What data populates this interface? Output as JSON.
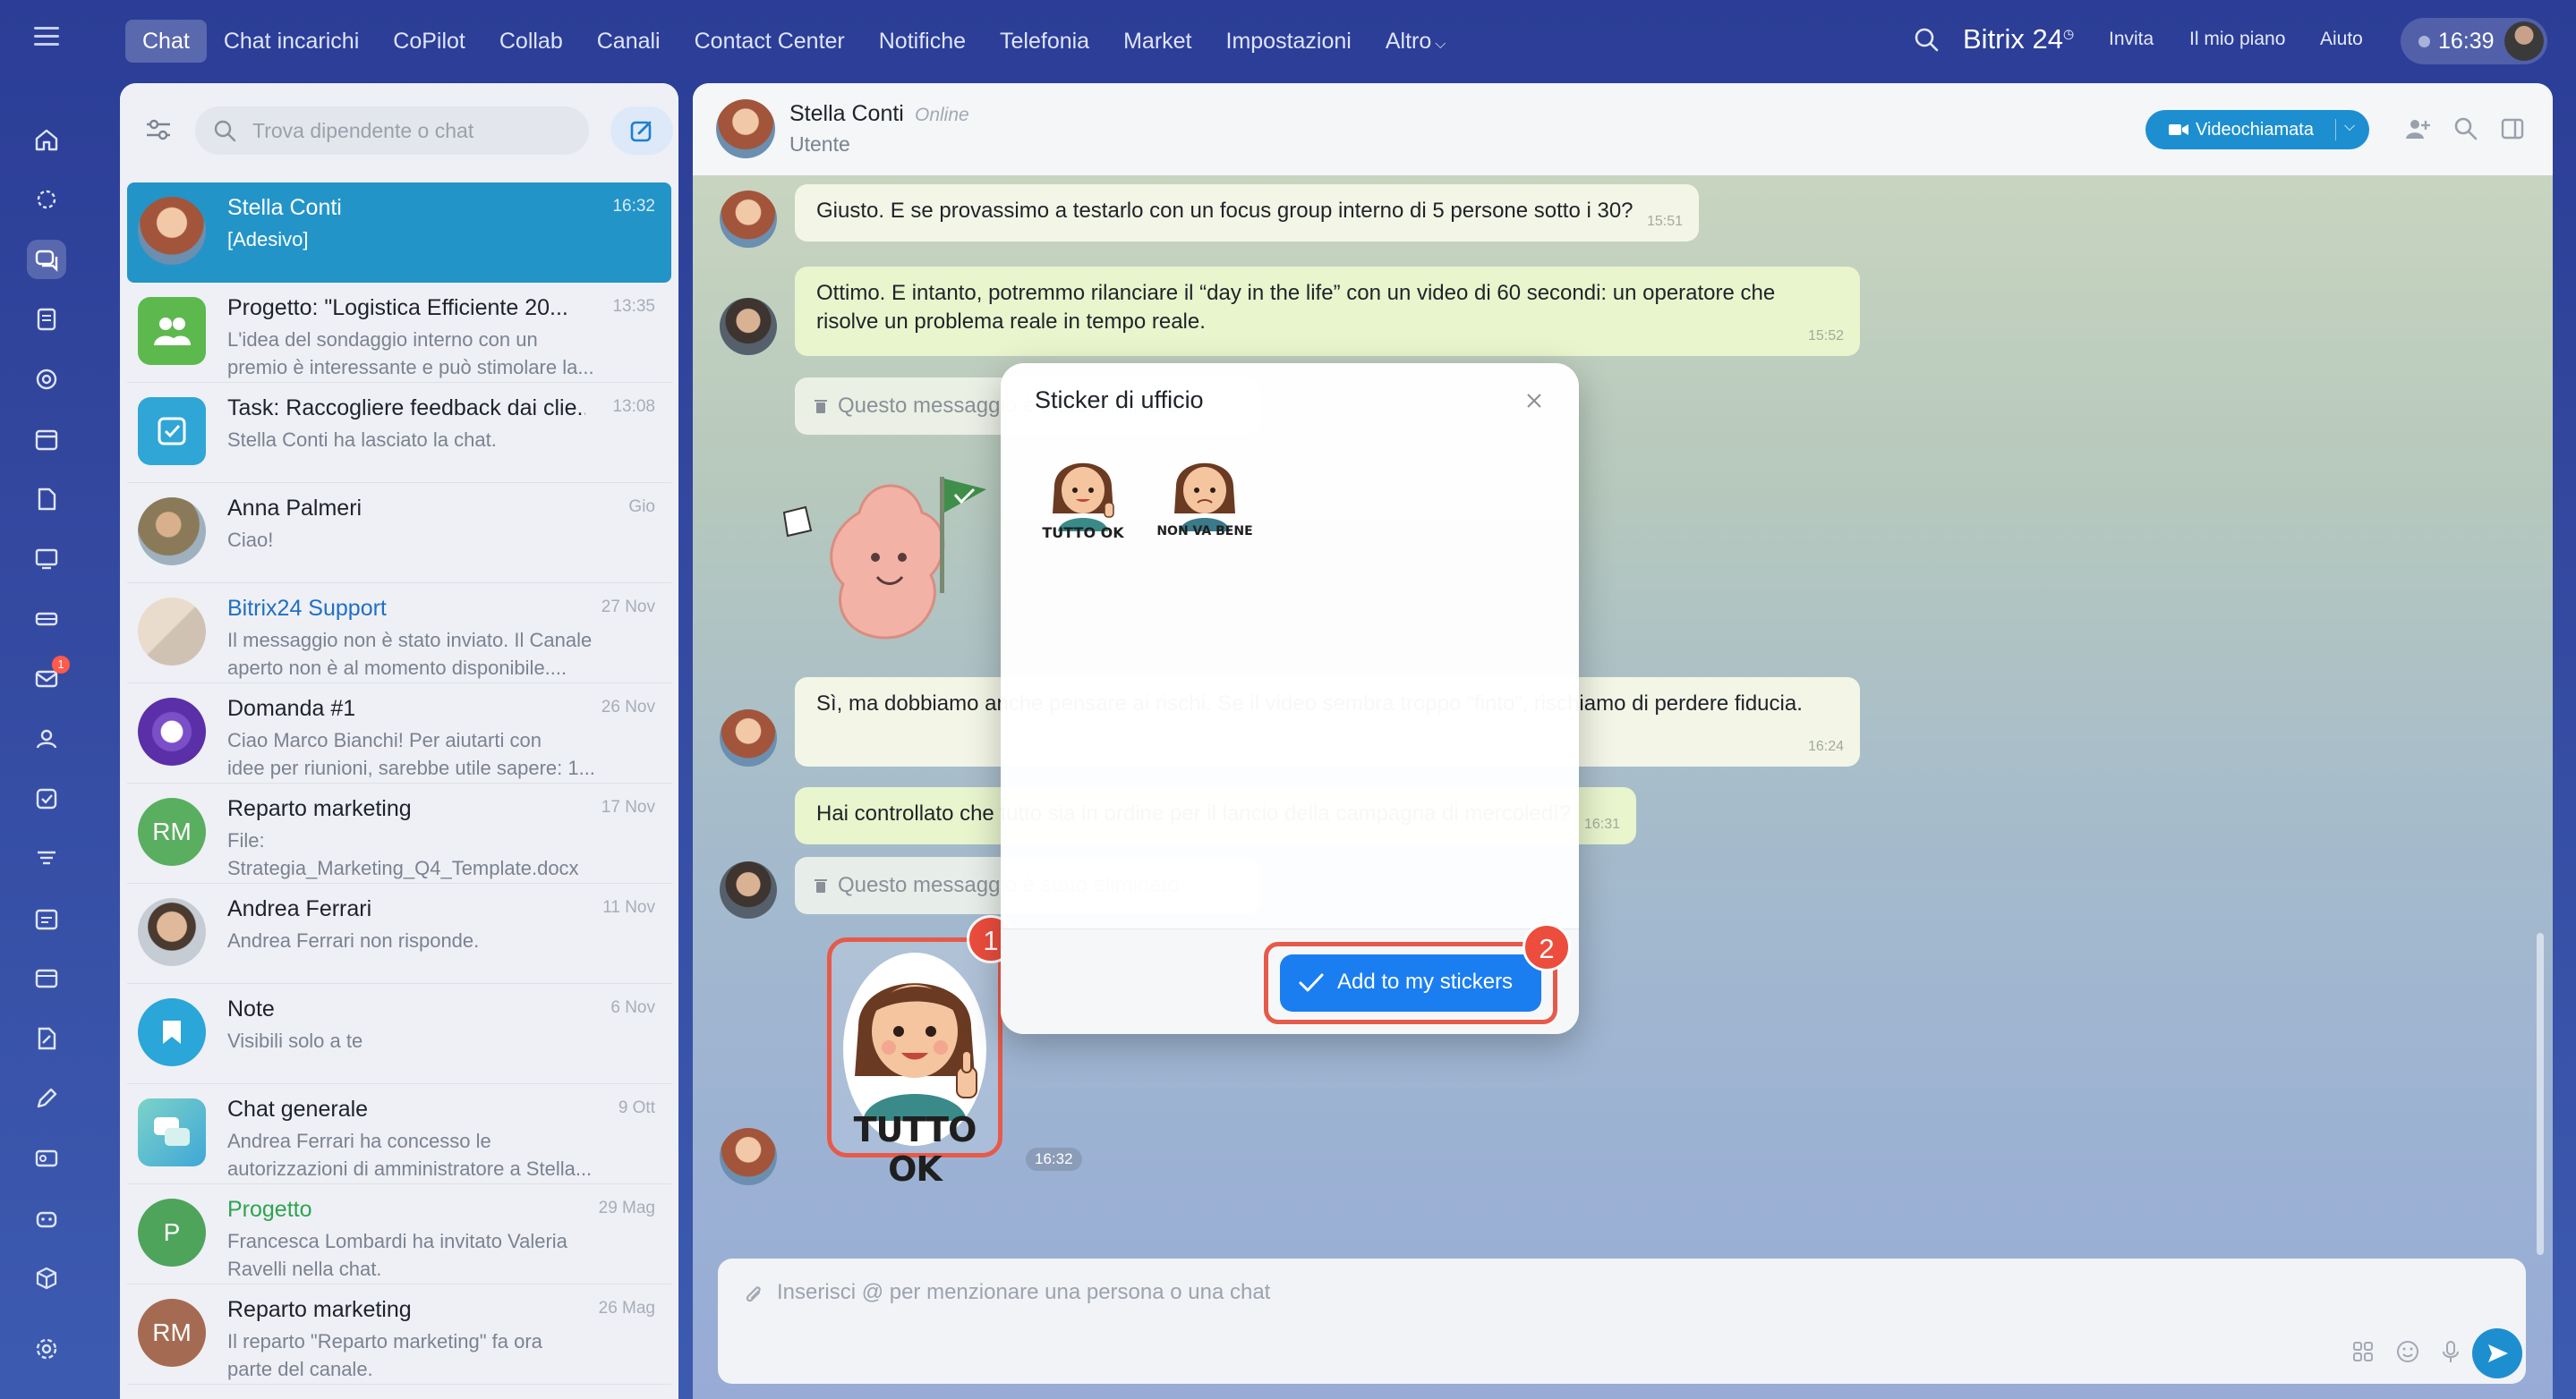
{
  "topbar": {
    "nav": [
      "Chat",
      "Chat incarichi",
      "CoPilot",
      "Collab",
      "Canali",
      "Contact Center",
      "Notifiche",
      "Telefonia",
      "Market",
      "Impostazioni",
      "Altro"
    ],
    "brand": "Bitrix 24",
    "links": {
      "invite": "Invita",
      "plan": "Il mio piano",
      "help": "Aiuto"
    },
    "clock": "16:39"
  },
  "rail": {
    "icons": [
      "home-icon",
      "activity-icon",
      "chat-icon",
      "feed-icon",
      "circle-icon",
      "calendar-icon",
      "document-icon",
      "board-icon",
      "drive-icon",
      "mail-icon",
      "contacts-icon",
      "tasks-icon",
      "funnel-icon",
      "schedule-icon",
      "sites-icon",
      "sign-icon",
      "pen-icon",
      "cards-icon",
      "bot-icon",
      "box-icon",
      "settings-icon"
    ],
    "mail_badge": "1"
  },
  "list": {
    "search_placeholder": "Trova dipendente o chat",
    "chats": [
      {
        "name": "Stella Conti",
        "time": "16:32",
        "preview": "[Adesivo]"
      },
      {
        "name": "Progetto: \"Logistica Efficiente 20...",
        "time": "13:35",
        "preview": "L'idea del sondaggio interno con un\npremio è interessante e può stimolare la..."
      },
      {
        "name": "Task: Raccogliere feedback dai clie...",
        "time": "13:08",
        "preview": "Stella Conti ha lasciato la chat."
      },
      {
        "name": "Anna Palmeri",
        "time": "Gio",
        "preview": "Ciao!"
      },
      {
        "name": "Bitrix24 Support",
        "time": "27 Nov",
        "preview": "Il messaggio non è stato inviato. Il Canale\naperto non è al momento disponibile...."
      },
      {
        "name": "Domanda #1",
        "time": "26 Nov",
        "preview": "Ciao Marco Bianchi! Per aiutarti con\nidee per riunioni, sarebbe utile sapere: 1..."
      },
      {
        "name": "Reparto marketing",
        "time": "17 Nov",
        "preview": "File:\nStrategia_Marketing_Q4_Template.docx",
        "initials": "RM"
      },
      {
        "name": "Andrea Ferrari",
        "time": "11 Nov",
        "preview": "Andrea Ferrari non risponde."
      },
      {
        "name": "Note",
        "time": "6 Nov",
        "preview": "Visibili solo a te"
      },
      {
        "name": "Chat generale",
        "time": "9 Ott",
        "preview": "Andrea Ferrari ha concesso le\nautorizzazioni di amministratore a Stella..."
      },
      {
        "name": "Progetto",
        "time": "29 Mag",
        "preview": "Francesca Lombardi ha invitato Valeria\nRavelli nella chat.",
        "initials": "P"
      },
      {
        "name": "Reparto marketing",
        "time": "26 Mag",
        "preview": "Il reparto \"Reparto marketing\" fa ora\nparte del canale.",
        "initials": "RM"
      }
    ]
  },
  "chat": {
    "name": "Stella Conti",
    "status": "Online",
    "role": "Utente",
    "video_button": "Videochiamata",
    "messages": [
      {
        "text": "Giusto. E se provassimo a testarlo con un focus group interno di 5 persone sotto i 30?",
        "time": "15:51"
      },
      {
        "text": "Ottimo. E intanto, potremmo rilanciare il “day in the life” con un video di 60 secondi: un operatore che risolve un problema reale in tempo reale.",
        "time": "15:52"
      },
      {
        "text": "Questo messaggio è stato eliminato"
      },
      {
        "text": "Sì, ma dobbiamo anche pensare ai rischi. Se il video sembra troppo “finto”, rischiamo di perdere fiducia.",
        "time": "16:24"
      },
      {
        "text": "Hai controllato che tutto sia in ordine per il lancio della campagna di mercoledì?",
        "time": "16:31"
      },
      {
        "text": "Questo messaggio è stato eliminato"
      }
    ],
    "sticker_label": "TUTTO OK",
    "sticker_time": "16:32",
    "composer_placeholder": "Inserisci @ per menzionare una persona o una chat"
  },
  "modal": {
    "title": "Sticker di ufficio",
    "stickers": [
      "TUTTO OK",
      "NON VA BENE"
    ],
    "add_button": "Add to my stickers"
  },
  "annotations": {
    "first": "1",
    "second": "2"
  },
  "colors": {
    "accent": "#1d8fd0",
    "highlight": "#e65a4a",
    "button": "#1b7ef0"
  }
}
